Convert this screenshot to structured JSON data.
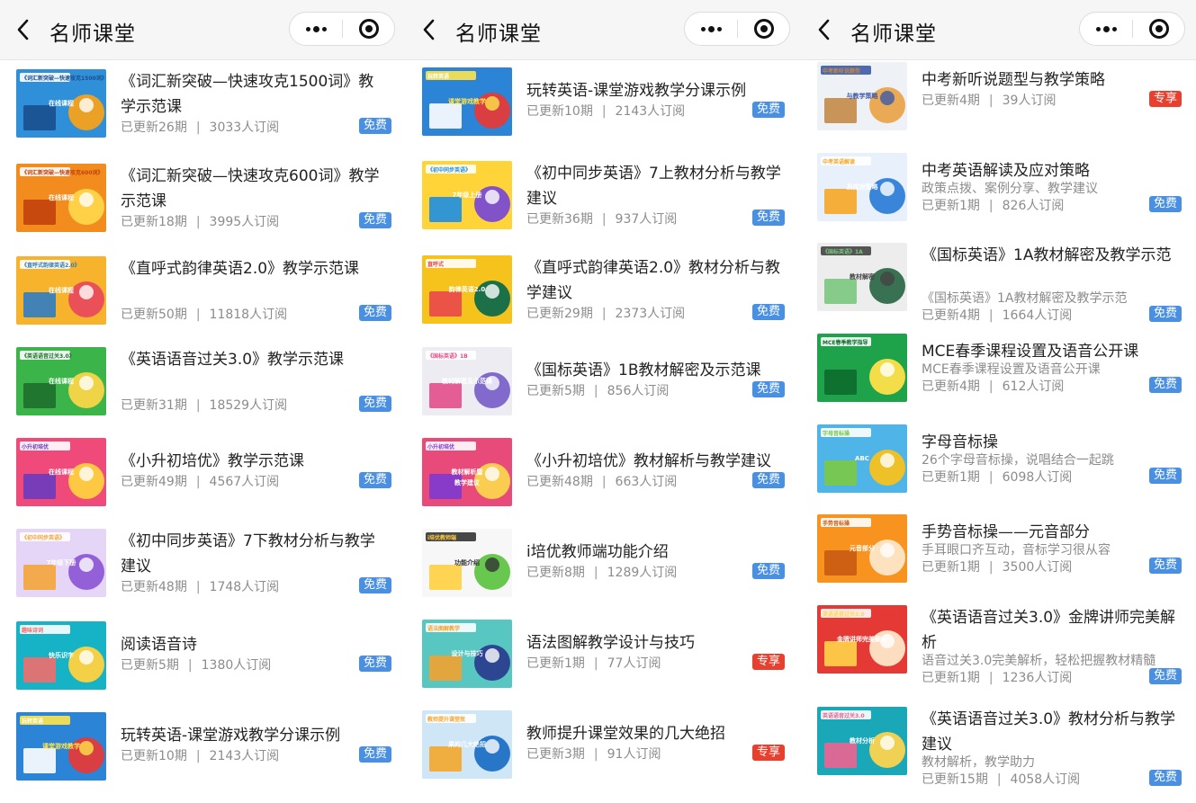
{
  "screens": [
    {
      "title": "名师课堂",
      "items": [
        {
          "title": "《词汇新突破—快速攻克1500词》教学示范课",
          "updated": "已更新26期",
          "subs": "3033人订阅",
          "badge": "免费",
          "thumb": "blue-orange"
        },
        {
          "title": "《词汇新突破—快速攻克600词》教学示范课",
          "updated": "已更新18期",
          "subs": "3995人订阅",
          "badge": "免费",
          "thumb": "orange-book"
        },
        {
          "title": "《直呼式韵律英语2.0》教学示范课",
          "updated": "已更新50期",
          "subs": "11818人订阅",
          "badge": "免费",
          "thumb": "orange-kids"
        },
        {
          "title": "《英语语音过关3.0》教学示范课",
          "updated": "已更新31期",
          "subs": "18529人订阅",
          "badge": "免费",
          "thumb": "green-book"
        },
        {
          "title": "《小升初培优》教学示范课",
          "updated": "已更新49期",
          "subs": "4567人订阅",
          "badge": "免费",
          "thumb": "pink-book"
        },
        {
          "title": "《初中同步英语》7下教材分析与教学建议",
          "updated": "已更新48期",
          "subs": "1748人订阅",
          "badge": "免费",
          "thumb": "lavender-book"
        },
        {
          "title": "阅读语音诗",
          "updated": "已更新5期",
          "subs": "1380人订阅",
          "badge": "免费",
          "thumb": "teal-kid"
        },
        {
          "title": "玩转英语-课堂游戏教学分课示例",
          "updated": "已更新10期",
          "subs": "2143人订阅",
          "badge": "免费",
          "thumb": "comic"
        }
      ]
    },
    {
      "title": "名师课堂",
      "items": [
        {
          "title": "玩转英语-课堂游戏教学分课示例",
          "updated": "已更新10期",
          "subs": "2143人订阅",
          "badge": "免费",
          "thumb": "comic"
        },
        {
          "title": "《初中同步英语》7上教材分析与教学建议",
          "updated": "已更新36期",
          "subs": "937人订阅",
          "badge": "免费",
          "thumb": "yellow-book"
        },
        {
          "title": "《直呼式韵律英语2.0》教材分析与教学建议",
          "updated": "已更新29期",
          "subs": "2373人订阅",
          "badge": "免费",
          "thumb": "yellow-board"
        },
        {
          "title": "《国标英语》1B教材解密及示范课",
          "updated": "已更新5期",
          "subs": "856人订阅",
          "badge": "免费",
          "thumb": "grey-slide"
        },
        {
          "title": "《小升初培优》教材解析与教学建议",
          "updated": "已更新48期",
          "subs": "663人订阅",
          "badge": "免费",
          "thumb": "pink-girls"
        },
        {
          "title": "i培优教师端功能介绍",
          "updated": "已更新8期",
          "subs": "1289人订阅",
          "badge": "免费",
          "thumb": "white-phone"
        },
        {
          "title": "语法图解教学设计与技巧",
          "updated": "已更新1期",
          "subs": "77人订阅",
          "badge": "专享",
          "thumb": "mint-board"
        },
        {
          "title": "教师提升课堂效果的几大绝招",
          "updated": "已更新3期",
          "subs": "91人订阅",
          "badge": "专享",
          "thumb": "lightblue-pc"
        }
      ]
    },
    {
      "title": "名师课堂",
      "items": [
        {
          "title": "中考新听说题型与教学策略",
          "subtitle": "",
          "updated": "已更新4期",
          "subs": "39人订阅",
          "badge": "专享",
          "thumb": "beige-question"
        },
        {
          "title": "中考英语解读及应对策略",
          "subtitle": "政策点拨、案例分享、教学建议",
          "updated": "已更新1期",
          "subs": "826人订阅",
          "badge": "免费",
          "thumb": "blue-screen"
        },
        {
          "title": "《国标英语》1A教材解密及教学示范",
          "subtitle": "《国标英语》1A教材解密及教学示范",
          "updated": "已更新4期",
          "subs": "1664人订阅",
          "badge": "免费",
          "thumb": "grey-slide2"
        },
        {
          "title": "MCE春季课程设置及语音公开课",
          "subtitle": "MCE春季课程设置及语音公开课",
          "updated": "已更新4期",
          "subs": "612人订阅",
          "badge": "免费",
          "thumb": "green-tv"
        },
        {
          "title": "字母音标操",
          "subtitle": "26个字母音标操，说唱结合一起跳",
          "updated": "已更新1期",
          "subs": "6098人订阅",
          "badge": "免费",
          "thumb": "sky-letters"
        },
        {
          "title": "手势音标操——元音部分",
          "subtitle": "手耳眼口齐互动，音标学习很从容",
          "updated": "已更新1期",
          "subs": "3500人订阅",
          "badge": "免费",
          "thumb": "orange-woman"
        },
        {
          "title": "《英语语音过关3.0》金牌讲师完美解析",
          "subtitle": "语音过关3.0完美解析，轻松把握教材精髓",
          "updated": "已更新1期",
          "subs": "1236人订阅",
          "badge": "免费",
          "thumb": "red-woman"
        },
        {
          "title": "《英语语音过关3.0》教材分析与教学建议",
          "subtitle": "教材解析，教学助力",
          "updated": "已更新15期",
          "subs": "4058人订阅",
          "badge": "免费",
          "thumb": "teal-girl"
        }
      ]
    }
  ],
  "thumb_text": {
    "blue-orange": [
      "《词汇新突破—快速攻克1500词》",
      "在线课程"
    ],
    "orange-book": [
      "《词汇新突破—快速攻克600词》",
      "在线课程"
    ],
    "orange-kids": [
      "《直呼式韵律英语2.0》",
      "在线课程"
    ],
    "green-book": [
      "《英语语音过关3.0》",
      "在线课程"
    ],
    "pink-book": [
      "小升初培优",
      "在线课程"
    ],
    "lavender-book": [
      "《初中同步英语》",
      "7年级下册"
    ],
    "teal-kid": [
      "趣味诗词",
      "快乐识字"
    ],
    "comic": [
      "玩转英语",
      "课堂游戏教学"
    ],
    "yellow-book": [
      "《初中同步英语》",
      "7年级上册"
    ],
    "yellow-board": [
      "直呼式",
      "韵律英语2.0"
    ],
    "grey-slide": [
      "《国标英语》1B",
      "教材解密及示范课"
    ],
    "pink-girls": [
      "小升初培优",
      "教材解析暨",
      "教学建议"
    ],
    "white-phone": [
      "i培优教师端",
      "功能介绍"
    ],
    "mint-board": [
      "语法图解教学",
      "设计与技巧"
    ],
    "lightblue-pc": [
      "教师提升课堂效",
      "果的几大绝招"
    ],
    "beige-question": [
      "中考新听说题型",
      "与教学策略"
    ],
    "blue-screen": [
      "中考英语解读",
      "及应对策略"
    ],
    "grey-slide2": [
      "《国标英语》1A",
      "教材解密"
    ],
    "green-tv": [
      "MCE春季教学指导",
      ""
    ],
    "sky-letters": [
      "字母音标操",
      "ABC"
    ],
    "orange-woman": [
      "手势音标操",
      "元音部分"
    ],
    "red-woman": [
      "英语语音过关3.0",
      "金牌讲师完美解析"
    ],
    "teal-girl": [
      "英语语音过关3.0",
      "教材分析"
    ]
  },
  "colors": {
    "free_badge": "#4a90e2",
    "exclusive_badge": "#e8402f",
    "navbar_bg": "#f6f6f6",
    "title_text": "#222222",
    "meta_text": "#8c8c8c"
  },
  "icons": {
    "back": "chevron-left-icon",
    "more": "more-dots-icon",
    "close": "target-circle-icon"
  }
}
